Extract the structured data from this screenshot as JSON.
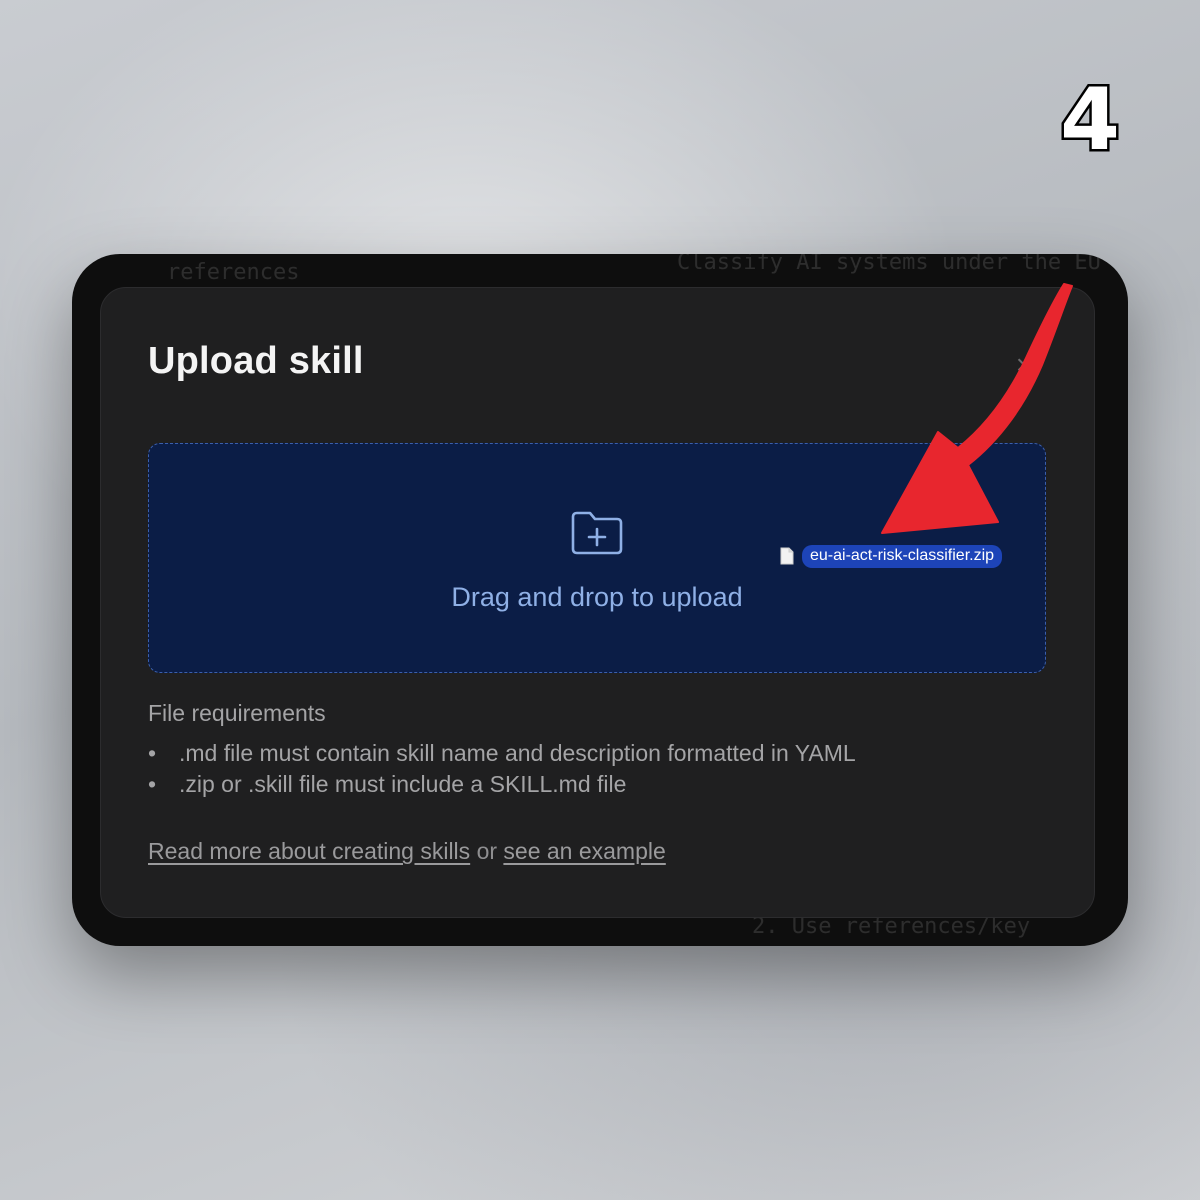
{
  "step_badge": "4",
  "dialog": {
    "title": "Upload skill",
    "close_symbol": "×",
    "dropzone": {
      "label": "Drag and drop to upload",
      "icon": "folder-plus-icon",
      "dragged_file": {
        "icon": "document-icon",
        "name": "eu-ai-act-risk-classifier.zip"
      }
    },
    "requirements": {
      "title": "File requirements",
      "items": [
        ".md file must contain skill name and description formatted in YAML",
        ".zip or .skill file must include a SKILL.md file"
      ]
    },
    "links": {
      "read_more": "Read more about creating skills",
      "connector": "or",
      "example": "see an example"
    }
  },
  "background_ghost_text": [
    "references",
    "Classify AI systems under the EU",
    "2.  Use references/key"
  ],
  "colors": {
    "dialog_bg": "#1f1f20",
    "dropzone_bg": "#0b1d46",
    "dropzone_text": "#8fb0e6",
    "file_chip": "#1d44b8",
    "arrow": "#e8262e"
  }
}
